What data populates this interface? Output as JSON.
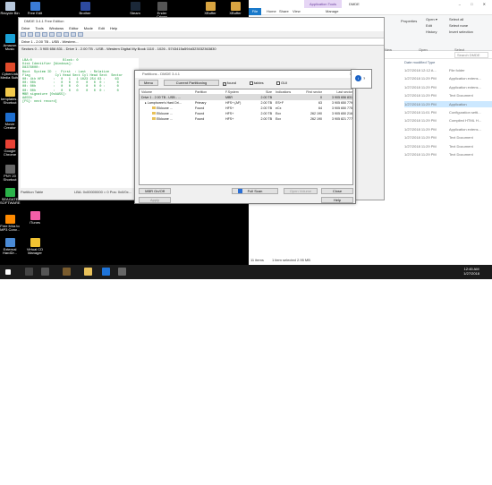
{
  "desktop": {
    "icons": [
      {
        "label": "Recycle Bin",
        "color": "#b7c8dc"
      },
      {
        "label": "Free Edit",
        "color": "#3a7bd5"
      },
      {
        "label": "Brother",
        "color": "#2d4aa0"
      },
      {
        "label": "Steam",
        "color": "#1b2838"
      },
      {
        "label": "Ender Crimm",
        "color": "#555555"
      },
      {
        "label": "XBuffer",
        "color": "#d9a441"
      },
      {
        "label": "XBuffer",
        "color": "#d9a441"
      },
      {
        "label": "Amazon Music",
        "color": "#1aa1d6"
      },
      {
        "label": "CyberLink Media Suite",
        "color": "#e04a2b"
      },
      {
        "label": "templates - Shortcut",
        "color": "#f2c94c"
      },
      {
        "label": "Movie Creator",
        "color": "#1e6fd0"
      },
      {
        "label": "Google Chrome",
        "color": "#e94235"
      },
      {
        "label": "PNY 20 Shortcut",
        "color": "#666666"
      },
      {
        "label": "SEAGATE SOFTWARE",
        "color": "#2bb34a"
      },
      {
        "label": "Free M4a to MP3 Conv...",
        "color": "#ff8a00"
      },
      {
        "label": "iTunes",
        "color": "#f35ea7"
      },
      {
        "label": "External HardDr...",
        "color": "#4b8bd6"
      },
      {
        "label": "Virtual CD Manager",
        "color": "#f1c232"
      }
    ]
  },
  "explorer": {
    "context_tab": "Application Tools",
    "title": "DMDE",
    "window_controls": "– □ ✕",
    "tabs": [
      "File",
      "Home",
      "Share",
      "View",
      "Manage"
    ],
    "ribbon": {
      "new_group": "New",
      "open_group": "Open",
      "select_group": "Select",
      "open_btn": "Open ▾",
      "edit_btn": "Edit",
      "history_btn": "History",
      "properties_btn": "Properties",
      "select_all": "Select all",
      "select_none": "Select none",
      "invert_selection": "Invert selection"
    },
    "search_placeholder": "Search DMDE",
    "column_header": "Date modified        Type",
    "rows": [
      {
        "date": "1/27/2018 12:12 A...",
        "type": "File folder",
        "selected": false
      },
      {
        "date": "1/27/2018 11:29 PM",
        "type": "Application extens...",
        "selected": false
      },
      {
        "date": "1/27/2018 11:29 PM",
        "type": "Application extens...",
        "selected": false
      },
      {
        "date": "1/27/2018 11:29 PM",
        "type": "Text Document",
        "selected": false
      },
      {
        "date": "1/27/2018 11:29 PM",
        "type": "Application",
        "selected": true
      },
      {
        "date": "1/27/2018 11:01 PM",
        "type": "Configuration setti...",
        "selected": false
      },
      {
        "date": "1/27/2018 11:29 PM",
        "type": "Compiled HTML H...",
        "selected": false
      },
      {
        "date": "1/27/2018 11:29 PM",
        "type": "Application extens...",
        "selected": false
      },
      {
        "date": "1/27/2018 11:29 PM",
        "type": "Text Document",
        "selected": false
      },
      {
        "date": "1/27/2018 11:29 PM",
        "type": "Text Document",
        "selected": false
      },
      {
        "date": "1/27/2018 11:29 PM",
        "type": "Text Document",
        "selected": false
      }
    ],
    "status_items": "11 items",
    "status_selected": "1 item selected  2.95 MB"
  },
  "testdisk": {
    "title": "DMDE 3.4.1 Free Edition",
    "menu": [
      "Drive",
      "Tools",
      "Windows",
      "Editor",
      "Mode",
      "Edit",
      "Help"
    ],
    "tab_label": "Drive 1 - 2.00 TB - USB - Western...",
    "info_line": "Sectors 0 - 3 905 656 831 - Drive 1 - 2.00 TB - USB - Western Digital My Book 1110 - 1026 - 5743415a594d323032363830",
    "hex_lines": [
      "LBA:0                Block: 0",
      "Disk Identifier [Windows]:",
      "D8376000:",
      "Boot  System ID  :  First  : Last  : Relative",
      "Flag             Cyl Head Sect Cyl Head Sect  Sector",
      "00: 4th HFS     :   0   1   1 1023 254 63 :     63",
      "00: 00h         :   0   0   0    0   0  0 :      0",
      "00: 00h         :   0   0   0    0   0  0 :      0",
      "00: 00h         :   0   0   0    0   0  0 :      0",
      "MBR signature [0xAA55]:",
      "AA55h",
      "[F5]: next record]"
    ],
    "partition_table": "Partition Table",
    "lba_text": "LBA: 0x00000000 = 0   Pos: 0x0/0x..."
  },
  "dmde": {
    "title": "Partitions - DMDE 3.4.1",
    "close_glyph": "✕",
    "menu_btn": "Menu",
    "current_partitioning_btn": "Current Partitioning",
    "found_label": "found",
    "found_checked": "✓",
    "tables_label": "tables",
    "gui_label": "GUI",
    "columns": {
      "volume": "Volume",
      "partition": "Partition",
      "fs": "F.System",
      "size": "Size",
      "indications": "Indications",
      "first": "First sector",
      "last": "Last sector"
    },
    "rows": [
      {
        "volume": "Drive 1 - 2.00 TB - USB - ...",
        "partition": "",
        "fs": "MBR",
        "size": "2.00 TB",
        "ind": "",
        "first": "0",
        "last": "3 905 656 831"
      },
      {
        "volume": "▸  Lamphoree's Hard Dri...",
        "partition": "Primary",
        "fs": "HFS+ (AF)",
        "size": "2.00 TB",
        "ind": "ES+F",
        "first": "63",
        "last": "3 905 650 779"
      },
      {
        "volume": "Elkloune ...",
        "partition": "Found",
        "fs": "HFS+",
        "size": "2.00 TB",
        "ind": "eCx",
        "first": "64",
        "last": "3 905 650 775"
      },
      {
        "volume": "Elkloune ...",
        "partition": "Found",
        "fs": "HFS+",
        "size": "2.00 TB",
        "ind": "Ecx",
        "first": "262 190",
        "last": "3 905 650 216"
      },
      {
        "volume": "Elkloune ...",
        "partition": "Found",
        "fs": "HFS+",
        "size": "2.00 TB",
        "ind": "Ecx",
        "first": "262 190",
        "last": "3 905 821 777"
      }
    ],
    "mbr_onoff_btn": "MBR On/Off",
    "apply_btn": "Apply",
    "full_scan_btn": "Full Scan",
    "open_volume_btn": "Open Volume",
    "close_btn": "Close",
    "help_btn": "Help"
  },
  "help_popover": {
    "question": "?"
  },
  "taskbar": {
    "time": "12:45 AM",
    "date": "1/27/2018"
  }
}
